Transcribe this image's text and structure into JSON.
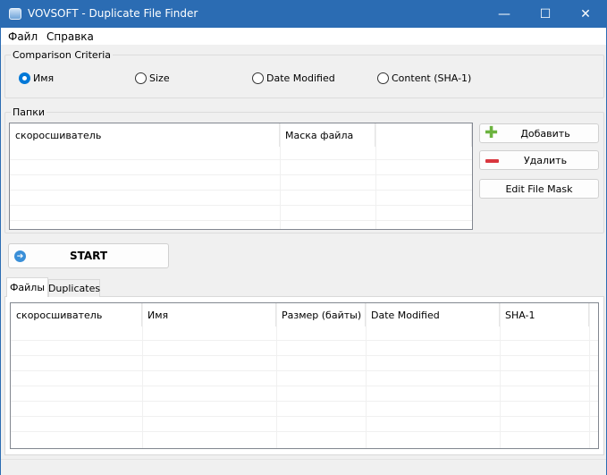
{
  "window": {
    "title": "VOVSOFT - Duplicate File Finder",
    "minimize": "—",
    "maximize": "☐",
    "close": "✕"
  },
  "menu": [
    "Файл",
    "Справка"
  ],
  "criteria": {
    "legend": "Comparison Criteria",
    "options": [
      "Имя",
      "Size",
      "Date Modified",
      "Content (SHA-1)"
    ],
    "selected": "Имя"
  },
  "folders": {
    "legend": "Папки",
    "columns": [
      "скоросшиватель",
      "Маска файла",
      ""
    ]
  },
  "buttons": {
    "add": "Добавить",
    "remove": "Удалить",
    "edit_mask": "Edit File Mask",
    "start": "START"
  },
  "tabs": [
    "Файлы",
    "Duplicates"
  ],
  "files": {
    "columns": [
      "скоросшиватель",
      "Имя",
      "Размер (байты)",
      "Date Modified",
      "SHA-1"
    ]
  },
  "colors": {
    "titlebar": "#2b6cb3",
    "accent": "#0078d7"
  }
}
